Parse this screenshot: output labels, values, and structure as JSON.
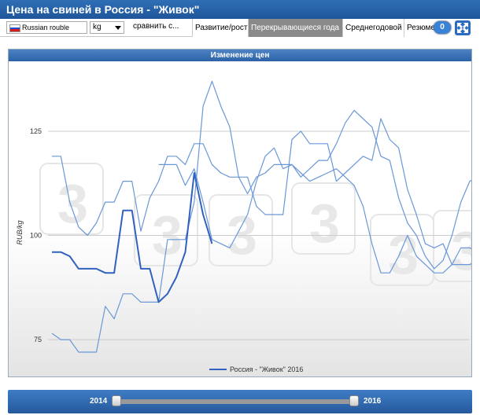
{
  "title": "Цена на свиней в Россия - \"Живок\"",
  "toolbar": {
    "currency": "Russian rouble",
    "unit": "kg",
    "compare": "сравнить с...",
    "tabs": [
      {
        "label": "Развитие/рост",
        "active": false
      },
      {
        "label": "Перекрывающиеся года",
        "active": true
      },
      {
        "label": "Среднегодовой",
        "active": false
      },
      {
        "label": "Резюме",
        "active": false
      }
    ],
    "badge": "0",
    "expand_icon": "expand-arrows-icon",
    "flag_colors": [
      "#ffffff",
      "#1c4fd6",
      "#d61c1c"
    ]
  },
  "chart_data": {
    "type": "line",
    "title": "Изменение цен",
    "ylabel": "RUB/kg",
    "xlabel": "",
    "yticks": [
      75,
      100,
      125
    ],
    "ylim": [
      72,
      138
    ],
    "x_count": 48,
    "legend": "Россия - \"Живок\" 2016",
    "legend_position": "bottom-center",
    "grid": true,
    "colors": {
      "thin": "#6a97d8",
      "bold": "#3162bf"
    },
    "series": [
      {
        "name": "",
        "width": "thin",
        "values": [
          119,
          119,
          108,
          102,
          100,
          103,
          108,
          108,
          113,
          113,
          101,
          109,
          113,
          119,
          119,
          117,
          122,
          122,
          117,
          115,
          114,
          114,
          110,
          114,
          115,
          117,
          117,
          117,
          114,
          116,
          118,
          118,
          122,
          127,
          130,
          128,
          126,
          119,
          118,
          109,
          103,
          100,
          95,
          92,
          94,
          100,
          108,
          113,
          114,
          112,
          112,
          119
        ]
      },
      {
        "name": "",
        "width": "thin",
        "values": [
          76.5,
          75,
          75,
          72,
          72,
          72,
          83,
          80,
          86,
          86,
          84,
          84,
          84,
          99,
          99,
          99,
          108,
          131,
          137,
          131,
          126,
          114,
          114,
          107,
          105,
          105,
          105,
          123,
          125,
          122,
          122,
          122,
          113,
          115,
          117,
          119,
          118,
          128,
          123,
          121,
          111,
          105,
          98,
          97,
          98,
          93,
          93,
          93,
          94,
          94,
          96,
          96,
          96
        ]
      },
      {
        "name": "",
        "width": "thin",
        "values": [
          null,
          null,
          null,
          null,
          null,
          null,
          null,
          null,
          null,
          null,
          null,
          null,
          117,
          117,
          117,
          112,
          116,
          108,
          99,
          98,
          97,
          101,
          105,
          113,
          119,
          121,
          116,
          117,
          115,
          113,
          114,
          115,
          116,
          114,
          112,
          107,
          98,
          91,
          91,
          95,
          100,
          95,
          93,
          91,
          91,
          93,
          97,
          97,
          96
        ]
      },
      {
        "name": "2016",
        "width": "bold",
        "values": [
          96,
          96,
          95,
          92,
          92,
          92,
          91,
          91,
          106,
          106,
          92,
          92,
          84,
          86,
          90,
          96,
          115,
          105,
          98
        ]
      }
    ]
  },
  "slider": {
    "start_label": "2014",
    "end_label": "2016",
    "start_frac": 0.0,
    "end_frac": 1.0
  }
}
